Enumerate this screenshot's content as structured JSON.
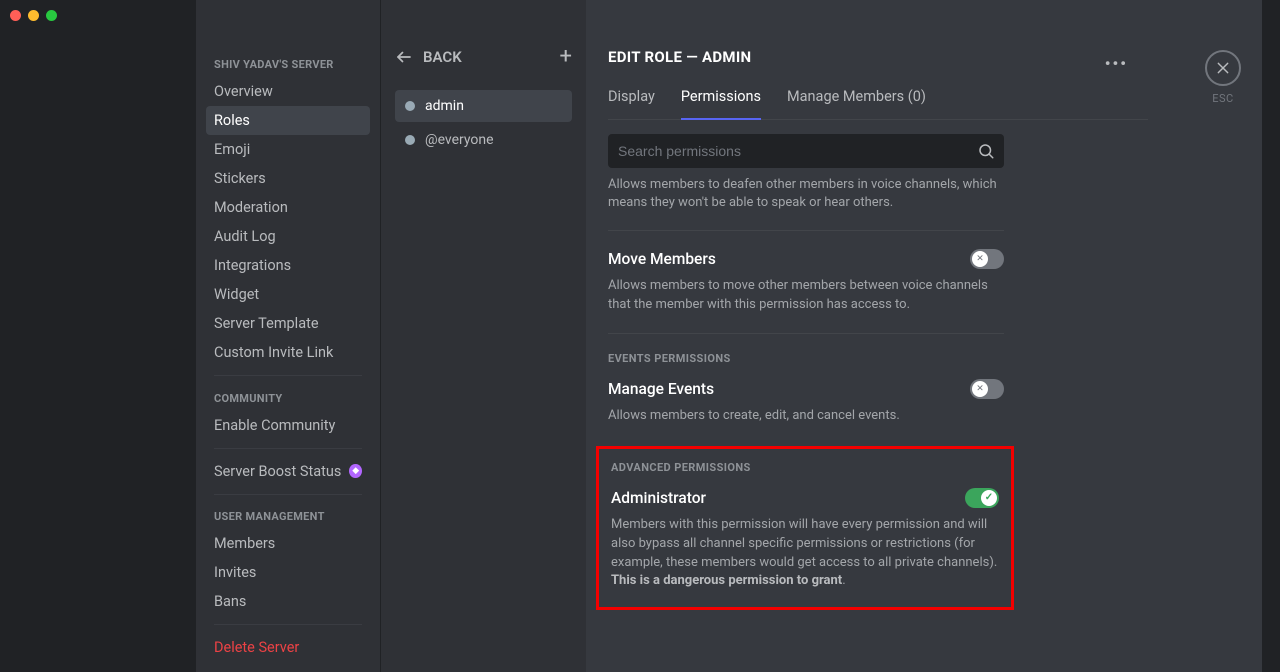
{
  "sidebar": {
    "server_heading": "SHIV YADAV'S SERVER",
    "items": [
      "Overview",
      "Roles",
      "Emoji",
      "Stickers",
      "Moderation",
      "Audit Log",
      "Integrations",
      "Widget",
      "Server Template",
      "Custom Invite Link"
    ],
    "active_index": 1,
    "community_heading": "COMMUNITY",
    "community_items": [
      "Enable Community"
    ],
    "boost_label": "Server Boost Status",
    "user_mgmt_heading": "USER MANAGEMENT",
    "user_mgmt_items": [
      "Members",
      "Invites",
      "Bans"
    ],
    "delete_label": "Delete Server"
  },
  "roles_column": {
    "back_label": "BACK",
    "roles": [
      {
        "name": "admin",
        "selected": true
      },
      {
        "name": "@everyone",
        "selected": false
      }
    ]
  },
  "main": {
    "title": "EDIT ROLE — ADMIN",
    "esc_label": "ESC",
    "tabs": [
      {
        "label": "Display",
        "active": false
      },
      {
        "label": "Permissions",
        "active": true
      },
      {
        "label": "Manage Members (0)",
        "active": false
      }
    ],
    "search_placeholder": "Search permissions",
    "cutoff_desc": "Allows members to deafen other members in voice channels, which means they won't be able to speak or hear others.",
    "move_members": {
      "title": "Move Members",
      "desc": "Allows members to move other members between voice channels that the member with this permission has access to.",
      "on": false
    },
    "events_heading": "EVENTS PERMISSIONS",
    "manage_events": {
      "title": "Manage Events",
      "desc": "Allows members to create, edit, and cancel events.",
      "on": false
    },
    "advanced_heading": "ADVANCED PERMISSIONS",
    "administrator": {
      "title": "Administrator",
      "desc_part1": "Members with this permission will have every permission and will also bypass all channel specific permissions or restrictions (for example, these members would get access to all private channels). ",
      "desc_bold": "This is a dangerous permission to grant",
      "desc_end": ".",
      "on": true
    }
  }
}
